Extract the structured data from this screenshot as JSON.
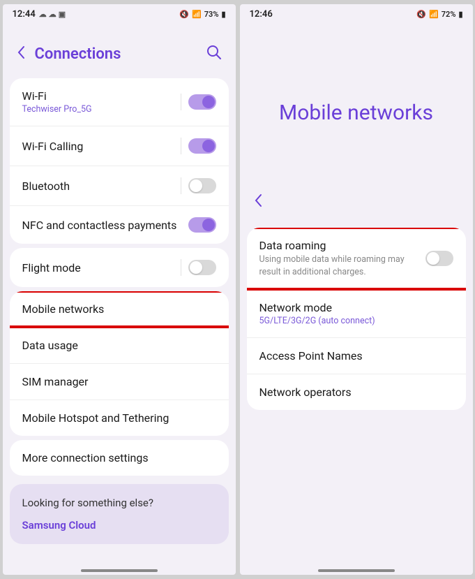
{
  "left": {
    "status": {
      "time": "12:44",
      "battery": "73%"
    },
    "header": {
      "title": "Connections"
    },
    "groups": [
      {
        "items": [
          {
            "label": "Wi-Fi",
            "sub": "Techwiser Pro_5G",
            "toggle": "on",
            "hasDivider": true
          },
          {
            "label": "Wi-Fi Calling",
            "toggle": "on",
            "hasDivider": true
          },
          {
            "label": "Bluetooth",
            "toggle": "off",
            "hasDivider": true
          },
          {
            "label": "NFC and contactless payments",
            "toggle": "on",
            "hasDivider": false
          }
        ]
      },
      {
        "items": [
          {
            "label": "Flight mode",
            "toggle": "off",
            "hasDivider": true
          }
        ]
      },
      {
        "items": [
          {
            "label": "Mobile networks",
            "highlight": true
          },
          {
            "label": "Data usage"
          },
          {
            "label": "SIM manager"
          },
          {
            "label": "Mobile Hotspot and Tethering"
          }
        ]
      },
      {
        "items": [
          {
            "label": "More connection settings"
          }
        ]
      }
    ],
    "suggestion": {
      "title": "Looking for something else?",
      "link": "Samsung Cloud"
    }
  },
  "right": {
    "status": {
      "time": "12:46",
      "battery": "72%"
    },
    "hero": "Mobile networks",
    "group": {
      "items": [
        {
          "label": "Data roaming",
          "subGray": "Using mobile data while roaming may result in additional charges.",
          "toggle": "off",
          "highlight": true
        },
        {
          "label": "Network mode",
          "sub": "5G/LTE/3G/2G (auto connect)"
        },
        {
          "label": "Access Point Names"
        },
        {
          "label": "Network operators"
        }
      ]
    }
  }
}
